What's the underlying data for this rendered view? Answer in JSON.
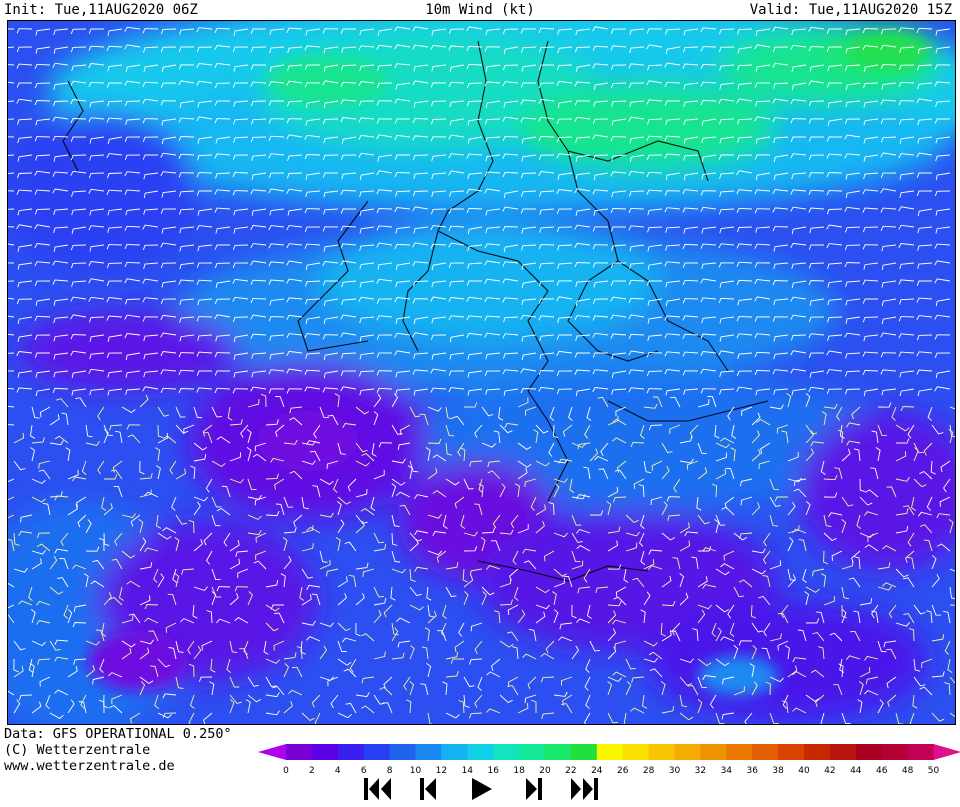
{
  "header": {
    "init": "Init: Tue,11AUG2020 06Z",
    "title": "10m Wind (kt)",
    "valid": "Valid: Tue,11AUG2020 15Z"
  },
  "footer": {
    "data_source": "Data: GFS OPERATIONAL 0.250°",
    "copyright": "(C) Wetterzentrale",
    "website": "www.wetterzentrale.de"
  },
  "legend": {
    "ticks": [
      "0",
      "2",
      "4",
      "6",
      "8",
      "10",
      "12",
      "14",
      "16",
      "18",
      "20",
      "22",
      "24",
      "26",
      "28",
      "30",
      "32",
      "34",
      "36",
      "38",
      "40",
      "42",
      "44",
      "46",
      "48",
      "50"
    ],
    "colors": [
      "#7a00d6",
      "#5b00e8",
      "#3b1ef2",
      "#2a3ff2",
      "#1e63ee",
      "#1a8af0",
      "#14b2f2",
      "#10d0e8",
      "#12e4c2",
      "#12e89a",
      "#18e86a",
      "#20e040",
      "#f8f800",
      "#f8e000",
      "#f8c600",
      "#f4ac00",
      "#f09200",
      "#ea7800",
      "#e25e00",
      "#d84400",
      "#c82a00",
      "#b81410",
      "#a8001e",
      "#b40038",
      "#c40056",
      "#dc007a"
    ],
    "under_color": "#b000f0",
    "over_color": "#e0108c"
  },
  "navigation": {
    "first_icon": "skip-to-first-icon",
    "prev_icon": "step-back-icon",
    "play_icon": "play-icon",
    "next_icon": "step-forward-icon",
    "last_icon": "skip-to-last-icon"
  }
}
